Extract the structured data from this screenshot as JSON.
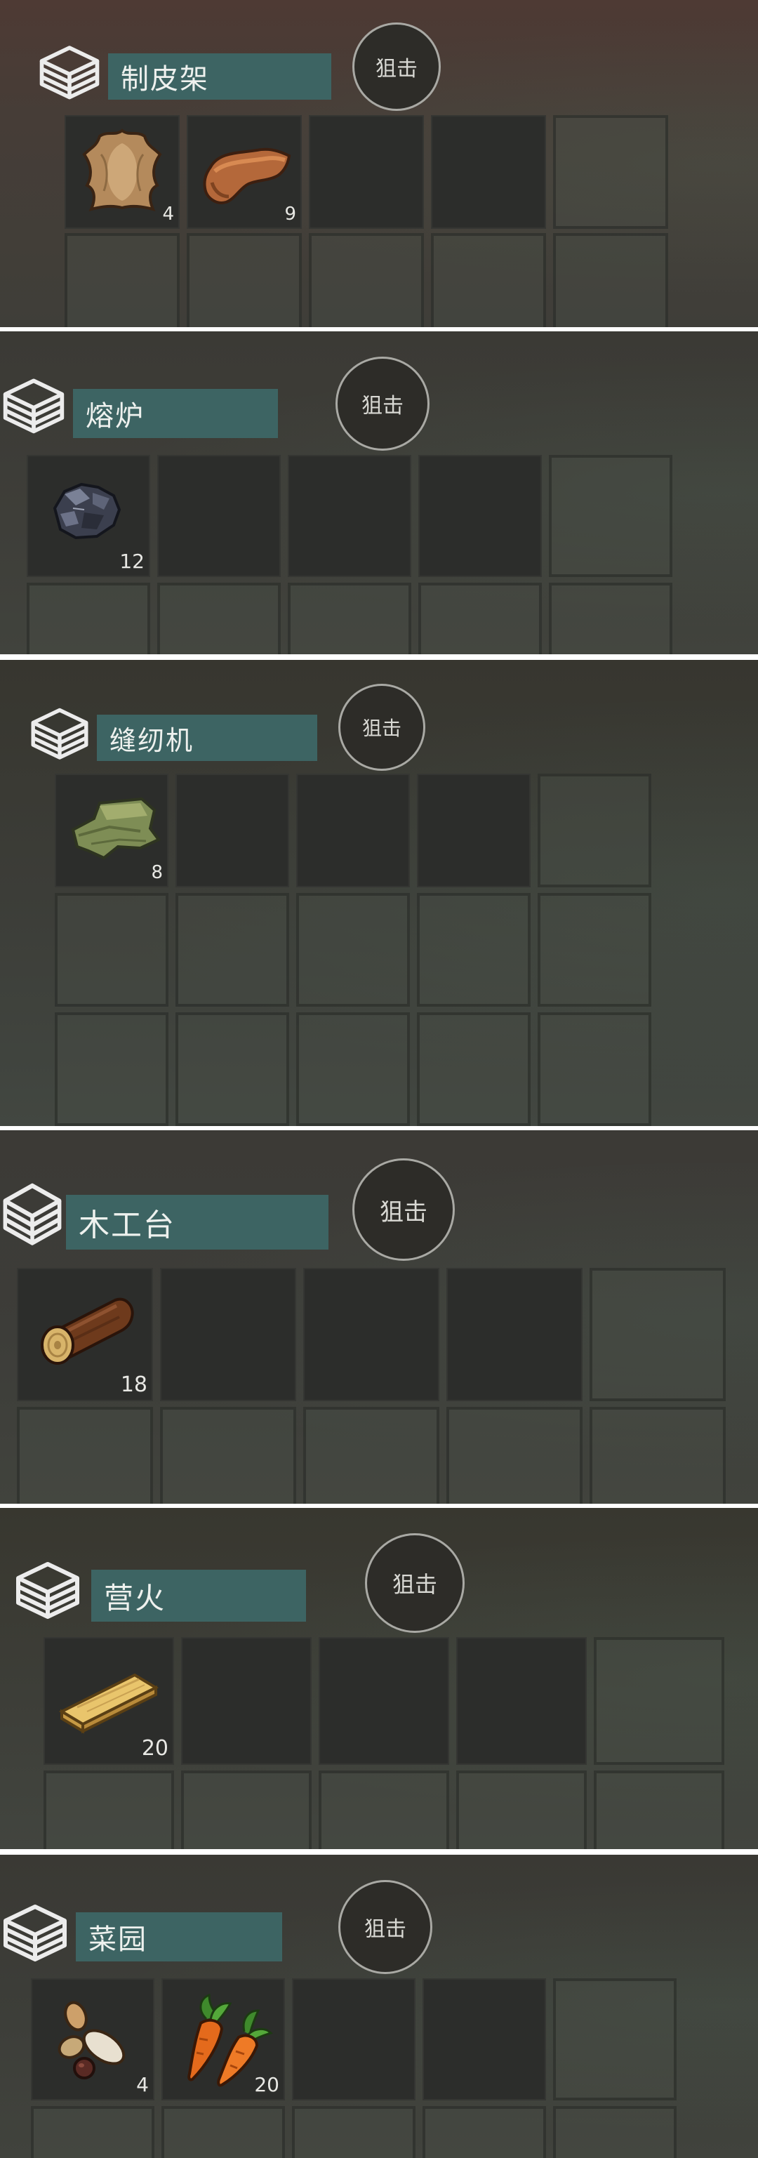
{
  "snipe_label": "狙击",
  "stations": [
    {
      "name": "制皮架",
      "items": [
        {
          "icon": "animal-hide-icon",
          "count": "4"
        },
        {
          "icon": "leather-icon",
          "count": "9"
        }
      ]
    },
    {
      "name": "熔炉",
      "items": [
        {
          "icon": "iron-ore-icon",
          "count": "12"
        }
      ]
    },
    {
      "name": "缝纫机",
      "items": [
        {
          "icon": "cloth-icon",
          "count": "8"
        }
      ]
    },
    {
      "name": "木工台",
      "items": [
        {
          "icon": "log-icon",
          "count": "18"
        }
      ]
    },
    {
      "name": "营火",
      "items": [
        {
          "icon": "plank-icon",
          "count": "20"
        }
      ]
    },
    {
      "name": "菜园",
      "items": [
        {
          "icon": "seeds-icon",
          "count": "4"
        },
        {
          "icon": "carrot-icon",
          "count": "20"
        }
      ]
    }
  ]
}
